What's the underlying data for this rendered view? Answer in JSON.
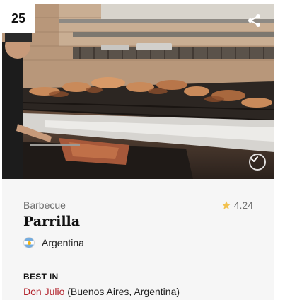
{
  "card": {
    "rank": "25",
    "photo_subject": "Parrilla",
    "category": "Barbecue",
    "rating": "4.24",
    "dish_name": "Parrilla",
    "country": {
      "name": "Argentina",
      "flag_icon": "argentina-flag-icon"
    },
    "best_in": {
      "label": "BEST IN",
      "place": "Don Julio",
      "location": " (Buenos Aires, Argentina)"
    },
    "icons": {
      "share": "share-icon",
      "check": "check-circle-icon",
      "star": "star-icon"
    },
    "colors": {
      "accent": "#b3262f",
      "star": "#f2c14e",
      "badge_bg": "#ffffff",
      "card_bg": "#f6f6f6"
    }
  }
}
